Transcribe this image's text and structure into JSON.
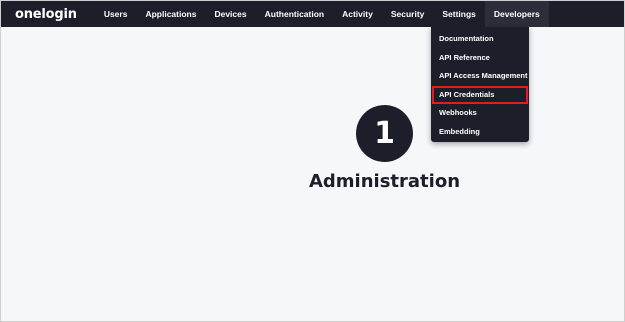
{
  "brand": {
    "logo_text": "onelogin"
  },
  "nav": {
    "items": [
      {
        "label": "Users"
      },
      {
        "label": "Applications"
      },
      {
        "label": "Devices"
      },
      {
        "label": "Authentication"
      },
      {
        "label": "Activity"
      },
      {
        "label": "Security"
      },
      {
        "label": "Settings"
      },
      {
        "label": "Developers",
        "active": true
      }
    ]
  },
  "developers_menu": {
    "items": [
      {
        "label": "Documentation"
      },
      {
        "label": "API Reference"
      },
      {
        "label": "API Access Management"
      },
      {
        "label": "API Credentials",
        "highlighted": true
      },
      {
        "label": "Webhooks"
      },
      {
        "label": "Embedding"
      }
    ]
  },
  "main": {
    "step_number": "1",
    "step_title": "Administration"
  },
  "colors": {
    "navbar_bg": "#1c1f2a",
    "page_bg": "#f6f7f9",
    "highlight_border": "#e31b23"
  }
}
